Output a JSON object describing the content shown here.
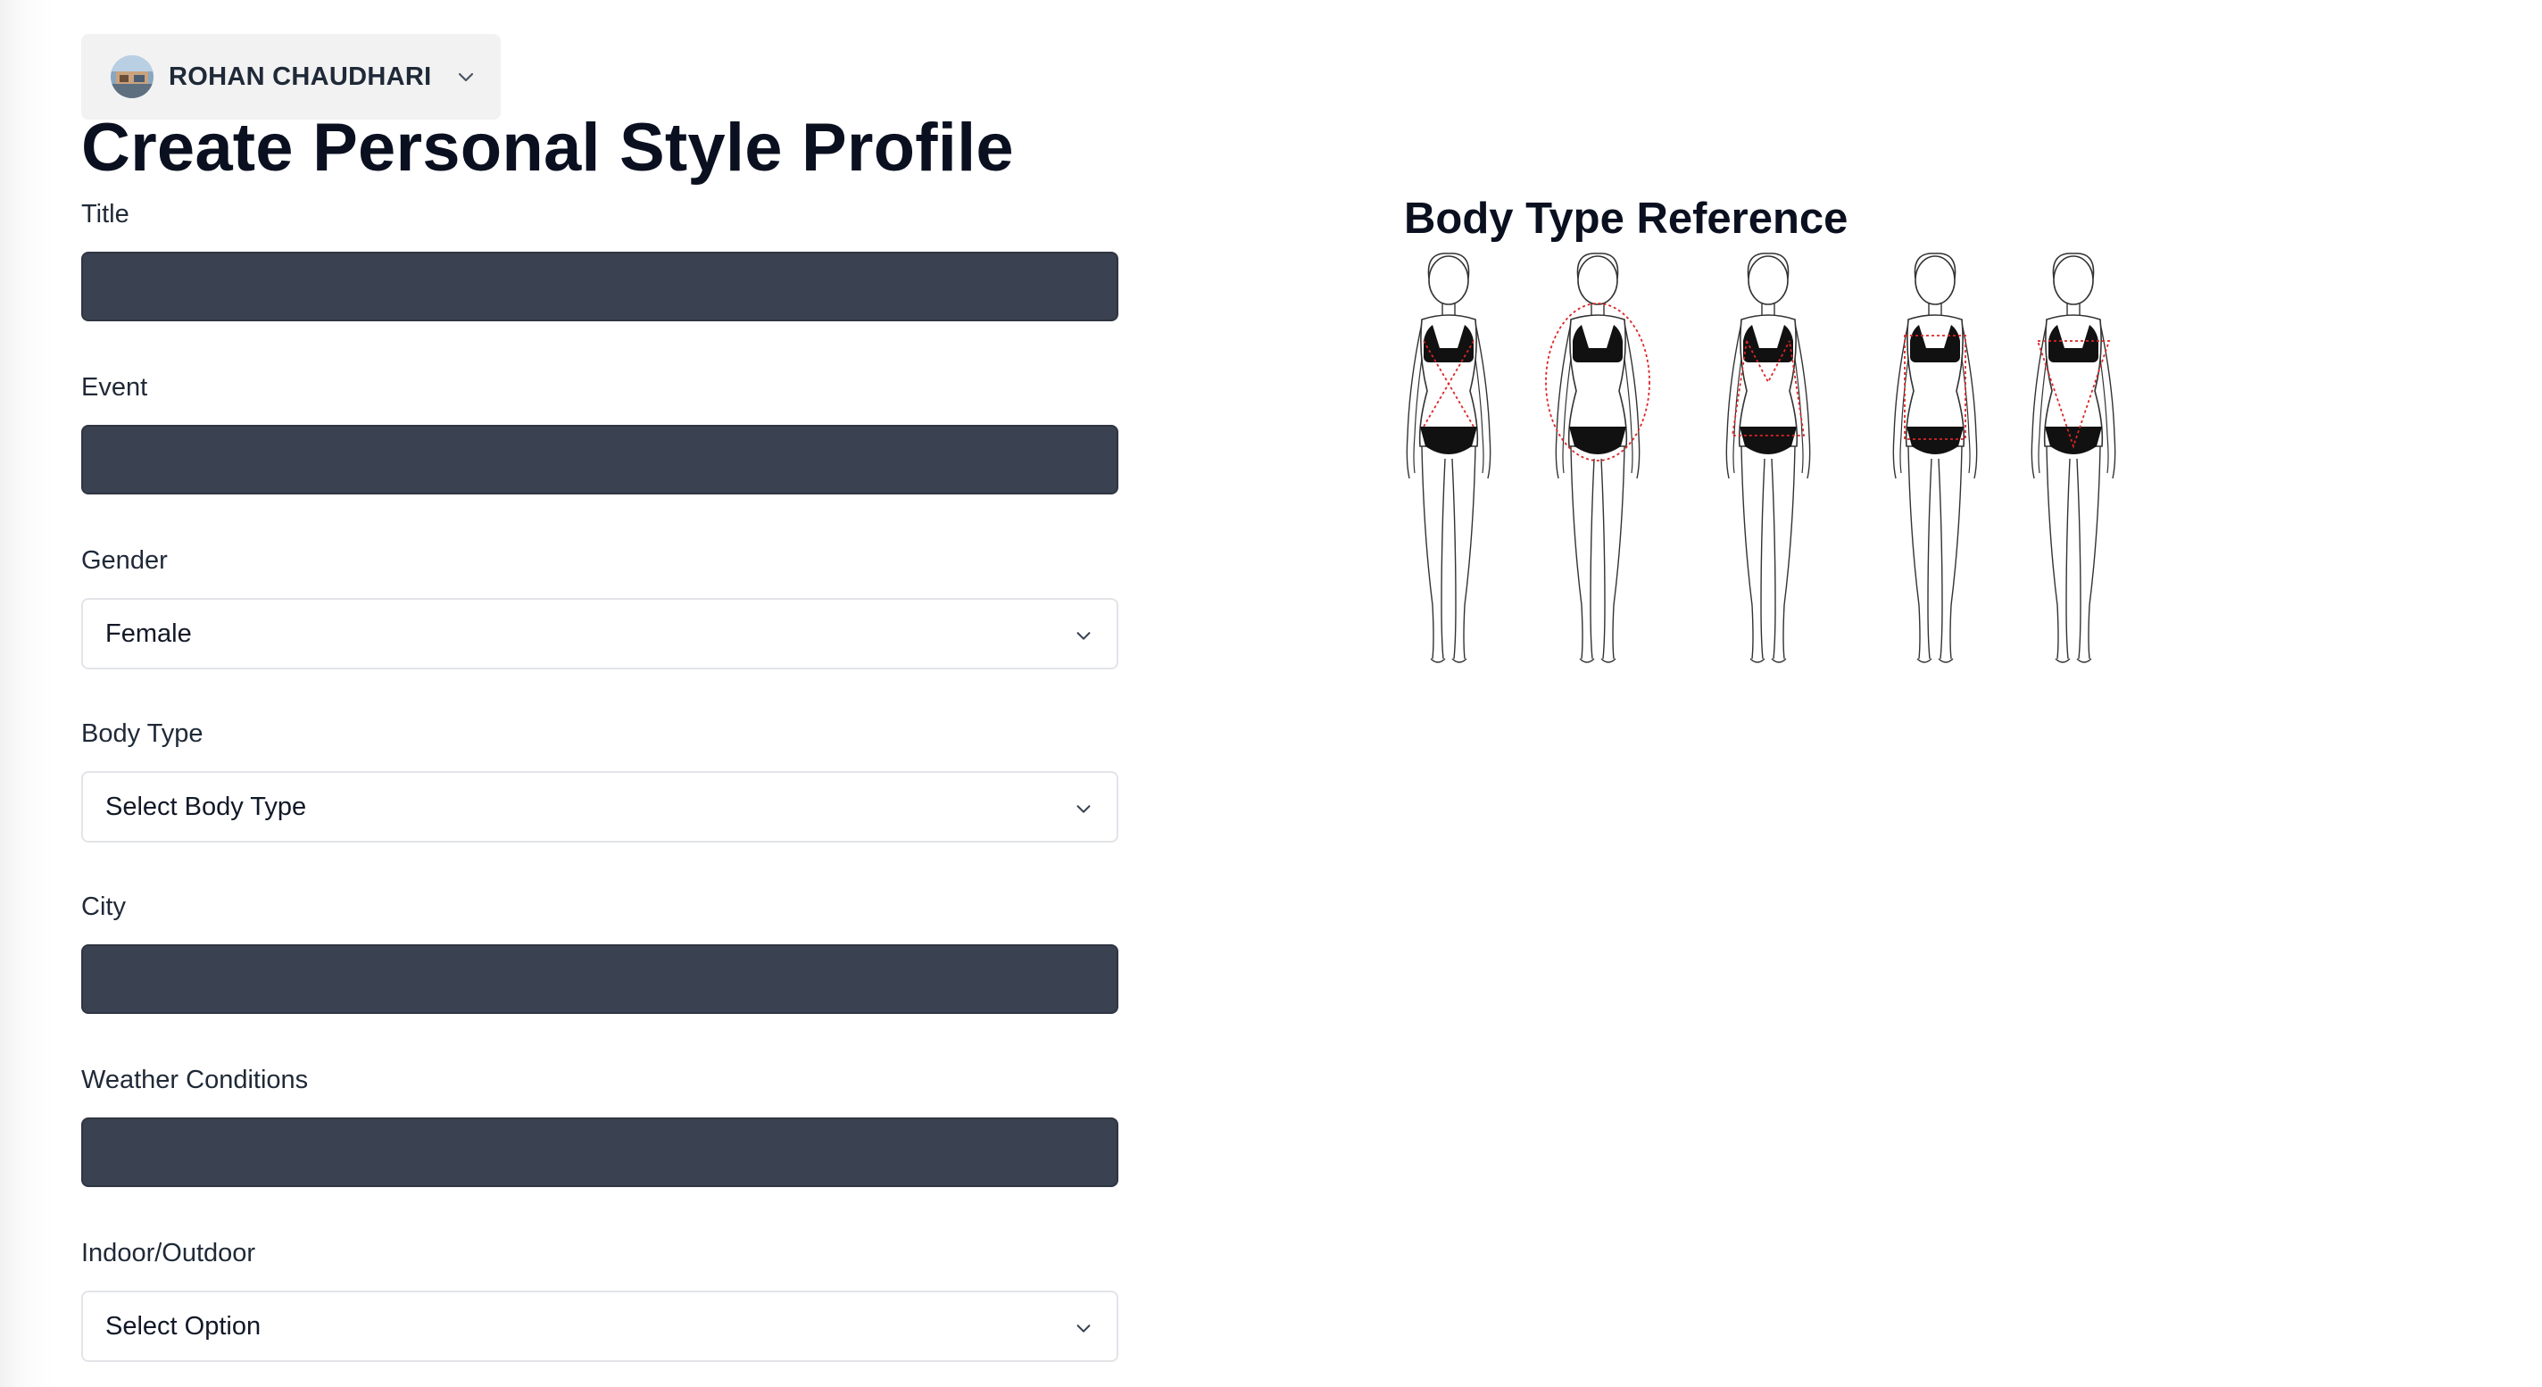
{
  "user": {
    "name": "ROHAN CHAUDHARI"
  },
  "page": {
    "title": "Create Personal Style Profile"
  },
  "form": {
    "title_label": "Title",
    "title_value": "",
    "event_label": "Event",
    "event_value": "",
    "gender_label": "Gender",
    "gender_value": "Female",
    "body_type_label": "Body Type",
    "body_type_value": "Select Body Type",
    "city_label": "City",
    "city_value": "",
    "weather_label": "Weather Conditions",
    "weather_value": "",
    "indoor_outdoor_label": "Indoor/Outdoor",
    "indoor_outdoor_value": "Select Option"
  },
  "reference": {
    "title": "Body Type Reference",
    "figure_count": 5
  },
  "colors": {
    "input_dark": "#3a4150",
    "chip_bg": "#f2f2f3",
    "outline_red": "#dc2626"
  }
}
